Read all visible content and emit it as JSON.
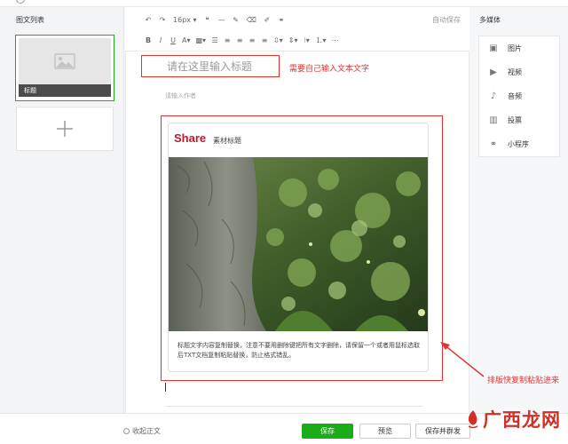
{
  "left_panel": {
    "heading": "图文列表",
    "article": {
      "caption": "标题"
    }
  },
  "toolbar": {
    "font_size": "16px",
    "autosave": "自动保存"
  },
  "editor": {
    "title_placeholder": "请在这里输入标题",
    "title_note": "需要自己输入文本文字",
    "author_placeholder": "请输入作者",
    "material": {
      "brand": "Share",
      "title": "素材标题",
      "body": "标题文字内容复制替换，注意不要用删除键把所有文字删除，请保留一个或者用鼠标选取后TXT文档复制粘贴替换，防止格式错乱。"
    }
  },
  "right_panel": {
    "heading": "多媒体",
    "items": [
      {
        "label": "图片",
        "icon": "image-icon"
      },
      {
        "label": "视频",
        "icon": "video-icon"
      },
      {
        "label": "音频",
        "icon": "microphone-icon"
      },
      {
        "label": "投票",
        "icon": "bar-chart-icon"
      },
      {
        "label": "小程序",
        "icon": "link-icon"
      }
    ]
  },
  "side_note": "排版快复制粘贴进来",
  "footer": {
    "collapse_label": "收起正文",
    "save_label": "保存",
    "preview_label": "预览",
    "send_label": "保存并群发"
  },
  "watermark": "广西龙网",
  "colors": {
    "accent_green": "#1aad19",
    "annotation_red": "#e03434",
    "brand_red": "#c0172e"
  }
}
